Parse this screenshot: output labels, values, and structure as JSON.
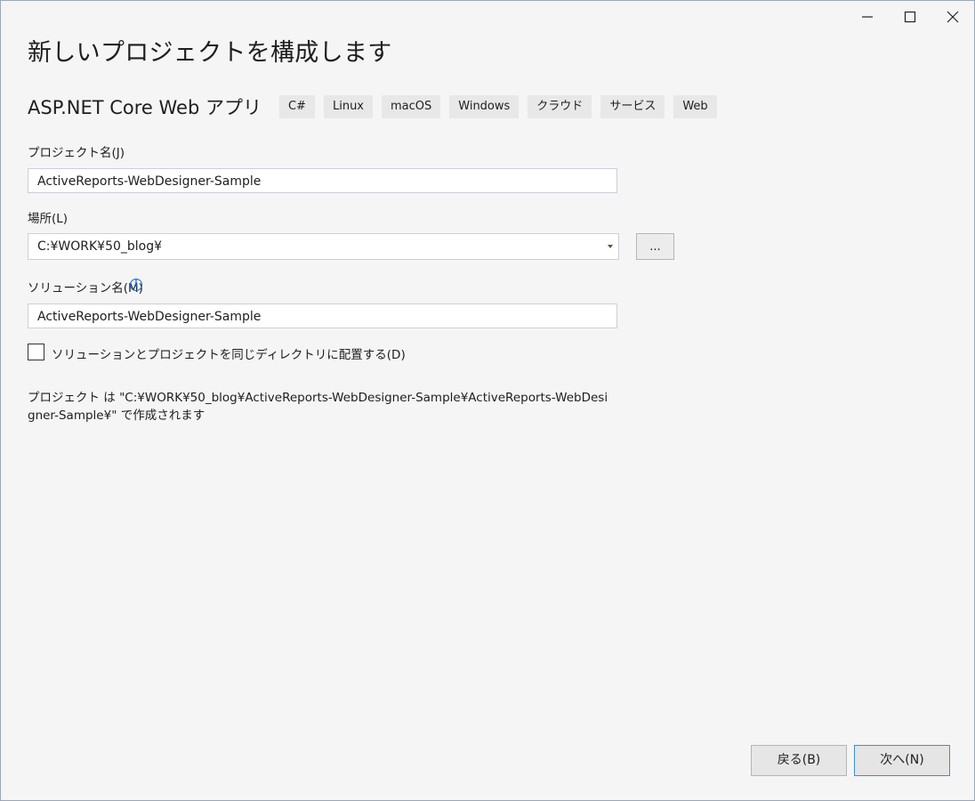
{
  "window": {
    "controls": [
      "minimize",
      "maximize",
      "close"
    ]
  },
  "page_title": "新しいプロジェクトを構成します",
  "template": {
    "name": "ASP.NET Core Web アプリ",
    "tags": [
      "C#",
      "Linux",
      "macOS",
      "Windows",
      "クラウド",
      "サービス",
      "Web"
    ]
  },
  "project_name": {
    "label": "プロジェクト名(J)",
    "value": "ActiveReports-WebDesigner-Sample"
  },
  "location": {
    "label": "場所(L)",
    "value": "C:¥WORK¥50_blog¥",
    "browse_label": "..."
  },
  "solution_name": {
    "label": "ソリューション名(M)",
    "value": "ActiveReports-WebDesigner-Sample",
    "info_icon": "i"
  },
  "same_dir": {
    "label": "ソリューションとプロジェクトを同じディレクトリに配置する(D)",
    "checked": false
  },
  "summary": "プロジェクト は \"C:¥WORK¥50_blog¥ActiveReports-WebDesigner-Sample¥ActiveReports-WebDesigner-Sample¥\" で作成されます",
  "footer": {
    "back_label": "戻る(B)",
    "next_label": "次へ(N)"
  }
}
